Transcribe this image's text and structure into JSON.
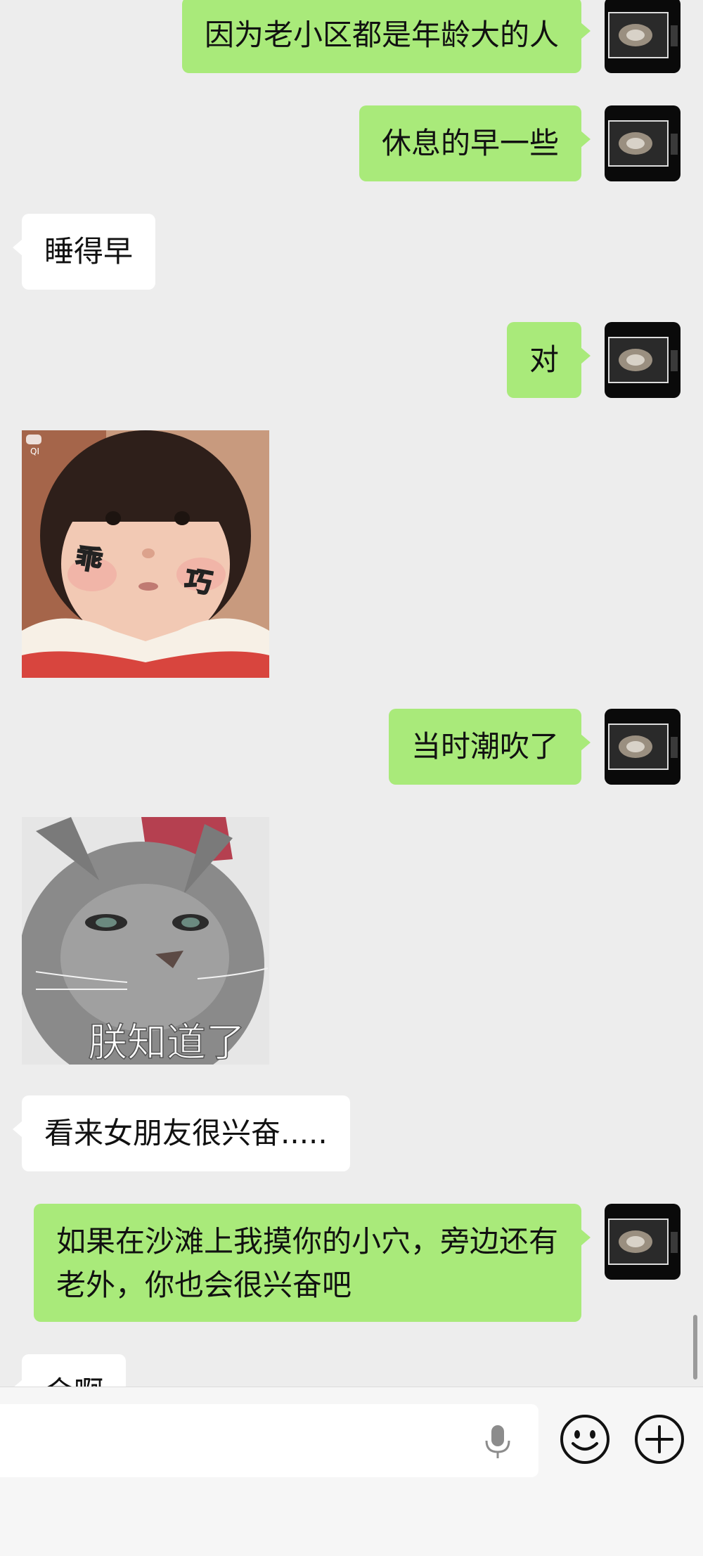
{
  "messages": [
    {
      "side": "out",
      "text": "因为老小区都是年龄大的人"
    },
    {
      "side": "out",
      "text": "休息的早一些"
    },
    {
      "side": "in",
      "text": "睡得早"
    },
    {
      "side": "out",
      "text": "对"
    },
    {
      "side": "in",
      "sticker": "girl-sticker",
      "caption_left": "乖",
      "caption_right": "巧",
      "corner_tag": "QI"
    },
    {
      "side": "out",
      "text": "当时潮吹了"
    },
    {
      "side": "in",
      "sticker": "cat-sticker",
      "caption": "朕知道了"
    },
    {
      "side": "in",
      "text": "看来女朋友很兴奋....."
    },
    {
      "side": "out",
      "text": "如果在沙滩上我摸你的小穴，旁边还有老外，你也会很兴奋吧"
    },
    {
      "side": "in",
      "text": "会啊"
    }
  ],
  "input_bar": {
    "icons": [
      "microphone-icon",
      "emoji-icon",
      "plus-icon"
    ]
  },
  "colors": {
    "background": "#ededed",
    "outgoing_bubble": "#a9ea7a",
    "incoming_bubble": "#ffffff"
  }
}
